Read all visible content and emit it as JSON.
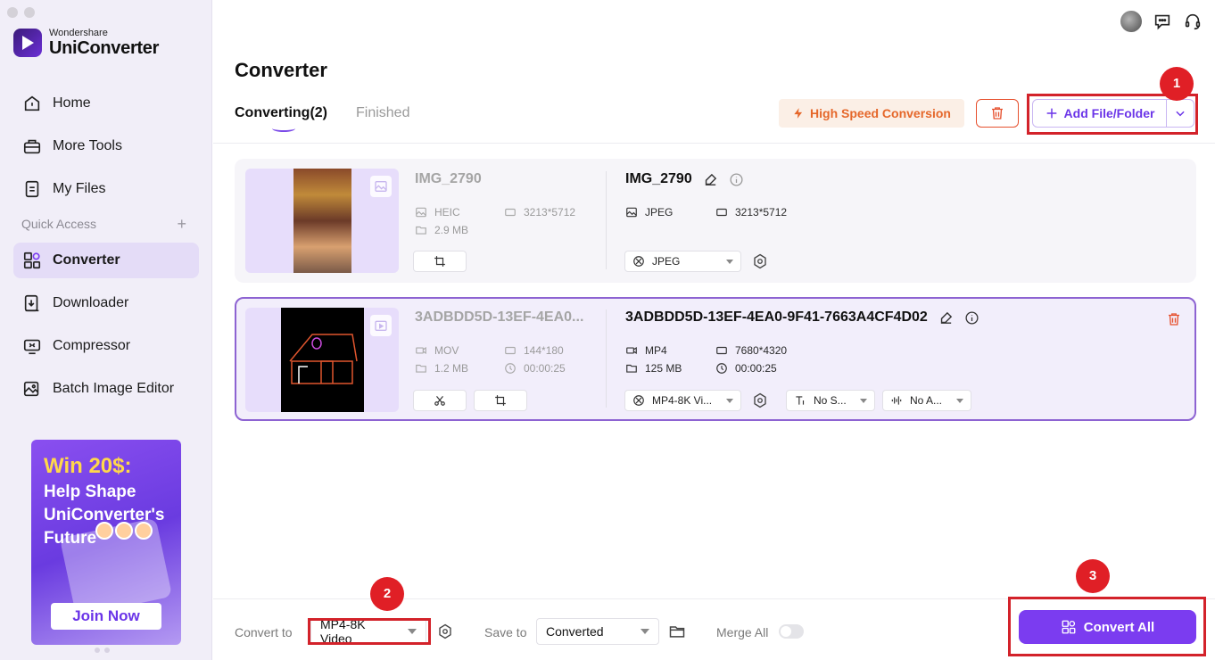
{
  "app": {
    "brand_small": "Wondershare",
    "brand_big": "UniConverter"
  },
  "sidebar": {
    "items": [
      {
        "label": "Home",
        "icon": "home-icon"
      },
      {
        "label": "More Tools",
        "icon": "toolbox-icon"
      },
      {
        "label": "My Files",
        "icon": "file-icon"
      }
    ],
    "quick_access_label": "Quick Access",
    "quick_items": [
      {
        "label": "Converter",
        "icon": "converter-icon",
        "active": true
      },
      {
        "label": "Downloader",
        "icon": "download-icon"
      },
      {
        "label": "Compressor",
        "icon": "compress-icon"
      },
      {
        "label": "Batch Image Editor",
        "icon": "image-edit-icon"
      }
    ],
    "promo": {
      "title": "Win 20$:",
      "subtitle": "Help Shape UniConverter's Future",
      "button": "Join Now"
    }
  },
  "header": {
    "title": "Converter",
    "tabs": [
      {
        "label": "Converting(2)",
        "active": true
      },
      {
        "label": "Finished",
        "active": false
      }
    ],
    "high_speed_label": "High Speed Conversion",
    "add_label": "Add File/Folder"
  },
  "annotations": [
    "1",
    "2",
    "3"
  ],
  "files": [
    {
      "src_name": "IMG_2790",
      "src_format": "HEIC",
      "src_resolution": "3213*5712",
      "src_size": "2.9 MB",
      "out_name": "IMG_2790",
      "out_format": "JPEG",
      "out_resolution": "3213*5712",
      "preset": "JPEG"
    },
    {
      "src_name": "3ADBDD5D-13EF-4EA0...",
      "src_format": "MOV",
      "src_resolution": "144*180",
      "src_size": "1.2 MB",
      "src_duration": "00:00:25",
      "out_name": "3ADBDD5D-13EF-4EA0-9F41-7663A4CF4D02",
      "out_format": "MP4",
      "out_resolution": "7680*4320",
      "out_size": "125 MB",
      "out_duration": "00:00:25",
      "preset": "MP4-8K Vi...",
      "subtitle": "No S...",
      "audio": "No A..."
    }
  ],
  "bottom": {
    "convert_to_label": "Convert to",
    "convert_to_value": "MP4-8K Video",
    "save_to_label": "Save to",
    "save_to_value": "Converted",
    "merge_label": "Merge All",
    "convert_all_label": "Convert All"
  },
  "colors": {
    "accent": "#7b3cf0",
    "annotation_red": "#d3222a",
    "high_speed": "#e5672a"
  }
}
